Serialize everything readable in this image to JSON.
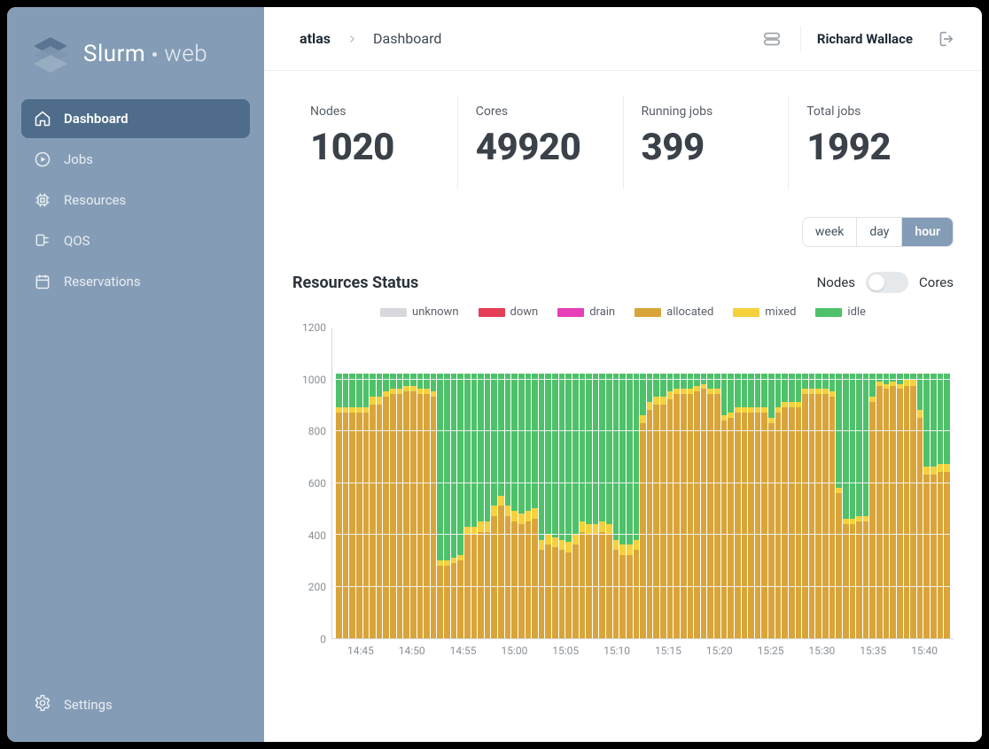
{
  "brand": {
    "pre": "Slurm",
    "post": "web"
  },
  "sidebar": {
    "items": [
      {
        "id": "dashboard",
        "label": "Dashboard",
        "active": true
      },
      {
        "id": "jobs",
        "label": "Jobs",
        "active": false
      },
      {
        "id": "resources",
        "label": "Resources",
        "active": false
      },
      {
        "id": "qos",
        "label": "QOS",
        "active": false
      },
      {
        "id": "reservations",
        "label": "Reservations",
        "active": false
      }
    ],
    "settings_label": "Settings"
  },
  "header": {
    "cluster": "atlas",
    "page": "Dashboard",
    "user": "Richard Wallace"
  },
  "stats": [
    {
      "label": "Nodes",
      "value": "1020"
    },
    {
      "label": "Cores",
      "value": "49920"
    },
    {
      "label": "Running jobs",
      "value": "399"
    },
    {
      "label": "Total jobs",
      "value": "1992"
    }
  ],
  "range": {
    "options": [
      "week",
      "day",
      "hour"
    ],
    "active": "hour"
  },
  "chart": {
    "title": "Resources Status",
    "toggle": {
      "left": "Nodes",
      "right": "Cores",
      "on_right": false
    }
  },
  "colors": {
    "unknown": "#d6d8dc",
    "down": "#e53e56",
    "drain": "#e63fb8",
    "allocated": "#d9a53a",
    "mixed": "#f5d13c",
    "idle": "#4fc16a"
  },
  "chart_data": {
    "type": "bar",
    "stack_total": 1020,
    "y_max": 1200,
    "ylabel": "",
    "xlabel": "",
    "title": "Resources Status",
    "y_ticks": [
      0,
      200,
      400,
      600,
      800,
      1000,
      1200
    ],
    "x_ticks": [
      "14:45",
      "14:50",
      "14:55",
      "15:00",
      "15:05",
      "15:10",
      "15:15",
      "15:20",
      "15:25",
      "15:30",
      "15:35",
      "15:40"
    ],
    "legend": [
      "unknown",
      "down",
      "drain",
      "allocated",
      "mixed",
      "idle"
    ],
    "series": [
      {
        "name": "allocated",
        "values": [
          870,
          870,
          870,
          870,
          870,
          900,
          900,
          930,
          940,
          940,
          950,
          950,
          940,
          940,
          930,
          280,
          280,
          290,
          300,
          400,
          400,
          410,
          410,
          470,
          510,
          470,
          450,
          440,
          450,
          460,
          340,
          360,
          350,
          340,
          330,
          360,
          410,
          400,
          400,
          410,
          400,
          340,
          320,
          320,
          340,
          830,
          880,
          900,
          900,
          920,
          940,
          940,
          940,
          950,
          960,
          940,
          940,
          840,
          850,
          870,
          870,
          870,
          870,
          870,
          830,
          870,
          890,
          890,
          890,
          940,
          940,
          940,
          940,
          930,
          560,
          440,
          440,
          450,
          450,
          910,
          970,
          960,
          970,
          960,
          970,
          970,
          850,
          630,
          630,
          640,
          640
        ]
      },
      {
        "name": "mixed",
        "values": [
          20,
          20,
          20,
          20,
          20,
          30,
          30,
          20,
          20,
          20,
          20,
          20,
          20,
          20,
          20,
          20,
          20,
          20,
          20,
          30,
          30,
          40,
          40,
          40,
          40,
          40,
          40,
          40,
          40,
          40,
          40,
          40,
          40,
          40,
          40,
          40,
          40,
          40,
          40,
          40,
          40,
          40,
          40,
          40,
          40,
          30,
          30,
          30,
          30,
          30,
          20,
          20,
          20,
          20,
          20,
          20,
          20,
          20,
          20,
          20,
          20,
          20,
          20,
          20,
          20,
          20,
          20,
          20,
          20,
          20,
          20,
          20,
          20,
          20,
          20,
          20,
          20,
          20,
          20,
          20,
          20,
          20,
          20,
          20,
          30,
          30,
          30,
          30,
          30,
          30,
          30
        ]
      }
    ]
  }
}
